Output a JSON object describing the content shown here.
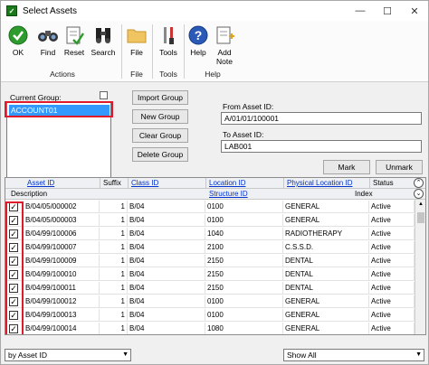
{
  "window": {
    "title": "Select Assets"
  },
  "ribbon": {
    "buttons": [
      {
        "label": "OK",
        "icon": "checkmark-icon"
      },
      {
        "label": "Find",
        "icon": "binoculars-icon"
      },
      {
        "label": "Reset",
        "icon": "reset-icon"
      },
      {
        "label": "Search",
        "icon": "search-binoculars-icon"
      },
      {
        "label": "File",
        "icon": "folder-icon"
      },
      {
        "label": "Tools",
        "icon": "tools-icon"
      },
      {
        "label": "Help",
        "icon": "help-icon"
      },
      {
        "label": "Add",
        "label2": "Note",
        "icon": "note-icon"
      }
    ],
    "groups": [
      "Actions",
      "File",
      "Tools",
      "Help"
    ]
  },
  "selection": {
    "current_group_label": "Current Group:",
    "current_group_value": "ACCOUNT01",
    "import_group": "Import Group",
    "new_group": "New Group",
    "clear_group": "Clear Group",
    "delete_group": "Delete Group",
    "from_asset_label": "From Asset ID:",
    "from_asset_value": "A/01/01/100001",
    "to_asset_label": "To Asset ID:",
    "to_asset_value": "LAB001",
    "mark": "Mark",
    "unmark": "Unmark"
  },
  "grid": {
    "headers_row1": [
      "Asset ID",
      "Suffix",
      "Class ID",
      "Location ID",
      "Physical Location ID",
      "Status"
    ],
    "headers_row2": [
      "Description",
      "Structure ID",
      "Index"
    ],
    "rows": [
      {
        "asset": "B/04/05/000002",
        "suffix": "1",
        "class": "B/04",
        "location": "0100",
        "physical": "GENERAL",
        "status": "Active"
      },
      {
        "asset": "B/04/05/000003",
        "suffix": "1",
        "class": "B/04",
        "location": "0100",
        "physical": "GENERAL",
        "status": "Active"
      },
      {
        "asset": "B/04/99/100006",
        "suffix": "1",
        "class": "B/04",
        "location": "1040",
        "physical": "RADIOTHERAPY",
        "status": "Active"
      },
      {
        "asset": "B/04/99/100007",
        "suffix": "1",
        "class": "B/04",
        "location": "2100",
        "physical": "C.S.S.D.",
        "status": "Active"
      },
      {
        "asset": "B/04/99/100009",
        "suffix": "1",
        "class": "B/04",
        "location": "2150",
        "physical": "DENTAL",
        "status": "Active"
      },
      {
        "asset": "B/04/99/100010",
        "suffix": "1",
        "class": "B/04",
        "location": "2150",
        "physical": "DENTAL",
        "status": "Active"
      },
      {
        "asset": "B/04/99/100011",
        "suffix": "1",
        "class": "B/04",
        "location": "2150",
        "physical": "DENTAL",
        "status": "Active"
      },
      {
        "asset": "B/04/99/100012",
        "suffix": "1",
        "class": "B/04",
        "location": "0100",
        "physical": "GENERAL",
        "status": "Active"
      },
      {
        "asset": "B/04/99/100013",
        "suffix": "1",
        "class": "B/04",
        "location": "0100",
        "physical": "GENERAL",
        "status": "Active"
      },
      {
        "asset": "B/04/99/100014",
        "suffix": "1",
        "class": "B/04",
        "location": "1080",
        "physical": "GENERAL",
        "status": "Active"
      }
    ]
  },
  "footer": {
    "sort_value": "by Asset ID",
    "filter_value": "Show All"
  },
  "colors": {
    "highlight": "#3399ff",
    "annotation": "#e0192b",
    "link": "#0033cc"
  }
}
